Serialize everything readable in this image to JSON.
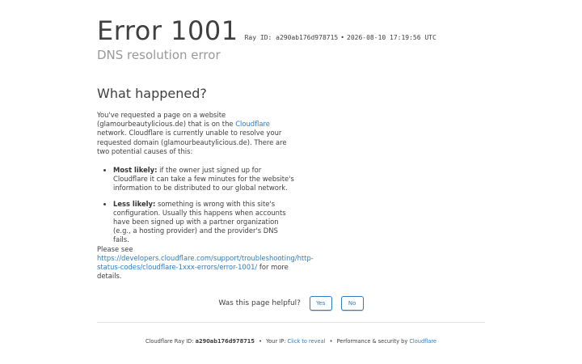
{
  "header": {
    "error_title": "Error 1001",
    "ray_label": "Ray ID: a290ab176d978715",
    "separator": "•",
    "timestamp": "2026-08-10 17:19:56 UTC",
    "subtitle": "DNS resolution error"
  },
  "main": {
    "heading": "What happened?",
    "intro_1": "You've requested a page on a website (glamourbeautylicious.de) that is on the ",
    "intro_link": "Cloudflare",
    "intro_2": " network. Cloudflare is currently unable to resolve your requested domain (glamourbeautylicious.de). There are two potential causes of this:",
    "items": [
      {
        "bold": "Most likely:",
        "text": " if the owner just signed up for Cloudflare it can take a few minutes for the website's information to be distributed to our global network."
      },
      {
        "bold": "Less likely:",
        "text": " something is wrong with this site's configuration. Usually this happens when accounts have been signed up with a partner organization (e.g., a hosting provider) and the provider's DNS fails."
      }
    ],
    "see_prefix": "Please see ",
    "see_link": "https://developers.cloudflare.com/support/troubleshooting/http-status-codes/cloudflare-1xxx-errors/error-1001/",
    "see_suffix": " for more details."
  },
  "feedback": {
    "question": "Was this page helpful?",
    "yes_label": "Yes",
    "no_label": "No"
  },
  "footer": {
    "ray_prefix": "Cloudflare Ray ID: ",
    "ray_id": "a290ab176d978715",
    "separator": "•",
    "ip_prefix": "Your IP: ",
    "ip_link": "Click to reveal",
    "perf_prefix": "Performance & security by ",
    "perf_link": "Cloudflare"
  },
  "colors": {
    "link": "#2f7bbf",
    "text": "#404040",
    "muted": "#999999"
  }
}
